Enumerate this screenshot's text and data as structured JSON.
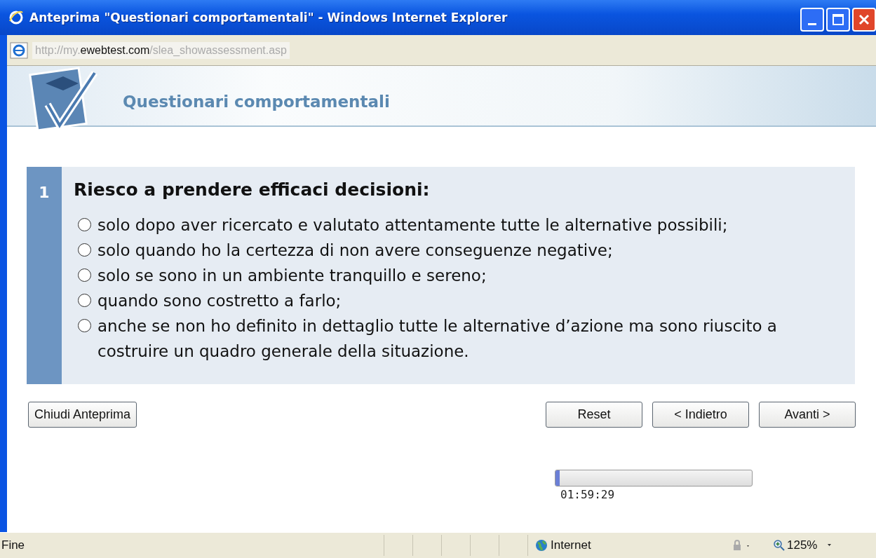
{
  "window": {
    "title": "Anteprima \"Questionari comportamentali\" - Windows Internet Explorer"
  },
  "address": {
    "prefix": "http://my.",
    "domain": "ewebtest.com",
    "path": "/slea_showassessment.asp"
  },
  "banner": {
    "title": "Questionari comportamentali"
  },
  "question": {
    "number": "1",
    "text": "Riesco a prendere efficaci decisioni:",
    "options": [
      {
        "label": "solo dopo aver ricercato e valutato attentamente tutte le alternative possibili;",
        "selected": false
      },
      {
        "label": "solo quando ho la certezza di non avere conseguenze negative;",
        "selected": false
      },
      {
        "label": "solo se sono in un ambiente tranquillo e sereno;",
        "selected": false
      },
      {
        "label": "quando sono costretto a farlo;",
        "selected": false
      },
      {
        "label": "anche se non ho definito in dettaglio tutte le alternative d’azione ma sono riuscito a costruire un quadro generale della situazione.",
        "selected": false
      }
    ]
  },
  "close_button": "Chiudi Anteprima",
  "nav_buttons": [
    "Reset",
    "< Indietro",
    "Avanti >"
  ],
  "timer": {
    "level": 0.02,
    "reading": "01:59:29"
  },
  "status_bar": {
    "text": "Fine",
    "zone": "Internet",
    "zoom": "125%"
  }
}
